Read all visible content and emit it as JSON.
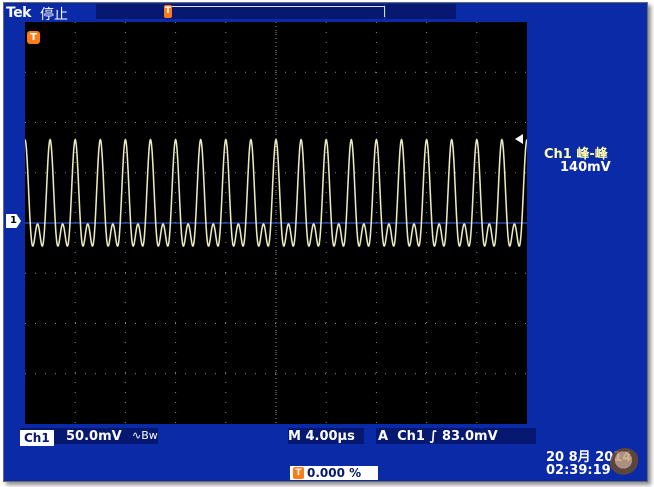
{
  "header": {
    "brand": "Tek",
    "state": "停止"
  },
  "measurement": {
    "label": "Ch1 峰-峰",
    "value": "140mV"
  },
  "channel": {
    "tag": "Ch1",
    "scale": "50.0mV",
    "coupling_symbol": "∿Bw"
  },
  "timebase": {
    "text": "M 4.00µs"
  },
  "trigger": {
    "mode": "A",
    "source": "Ch1",
    "slope": "∫",
    "level": "83.0mV",
    "position_icon": "T",
    "position": "0.000 %"
  },
  "markers": {
    "trigger_t": "T",
    "ground_ch1": "1",
    "record_t": "T"
  },
  "datetime": {
    "date": "20 8月  2014",
    "time": "02:39:19"
  },
  "icons": {
    "trigger_marker": "trigger-position-icon",
    "ground_marker": "channel-ground-icon",
    "level_marker": "trigger-level-arrow-icon"
  },
  "colors": {
    "screen_bg": "#0a2aa8",
    "graticule_bg": "#000000",
    "trace": "#f2f2b0",
    "marker_orange": "#ff7a18",
    "measurement_label": "#ffffaa"
  },
  "chart_data": {
    "type": "line",
    "series": [
      {
        "name": "",
        "description_units": "divisions",
        "waveform": "periodic two-tone signal"
      }
    ],
    "time_per_div_us": 4.0,
    "volts_per_div_mV": 50.0,
    "divisions_x": 10,
    "divisions_y": 8,
    "peak_to_peak_mV": 140,
    "period_us": 1.98,
    "cycles": 20,
    "grid": true
  }
}
